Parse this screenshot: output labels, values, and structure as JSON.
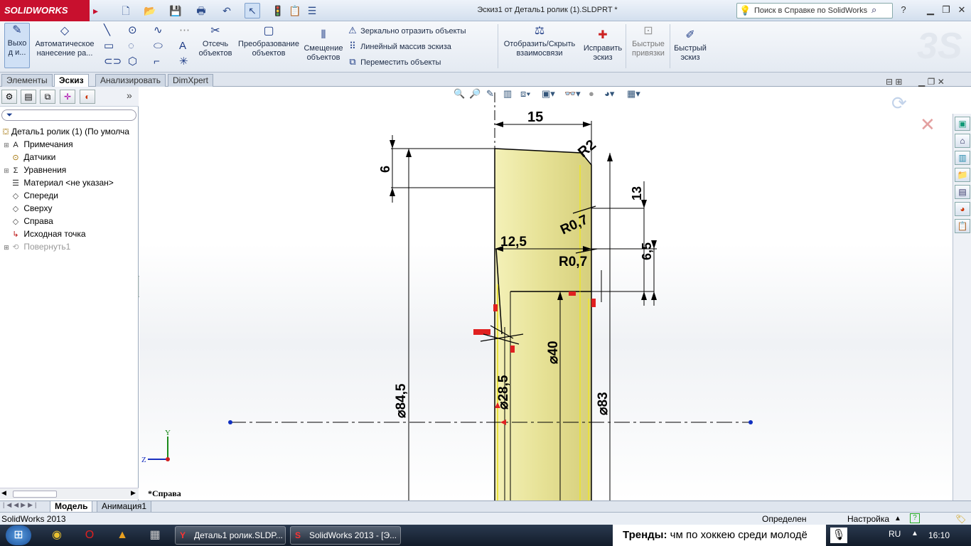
{
  "app": {
    "brand": "SOLIDWORKS",
    "doc_title": "Эскиз1 от Деталь1 ролик (1).SLDPRT *"
  },
  "help_search": {
    "placeholder": "Поиск в Справке по SolidWorks"
  },
  "ribbon": {
    "exit_sketch": "Выхо д и...",
    "auto_dim": "Автоматическое нанесение ра...",
    "trim": "Отсечь объектов",
    "convert": "Преобразование объектов",
    "offset": "Смещение объектов",
    "mirror": "Зеркально отразить объекты",
    "linear_pattern": "Линейный массив эскиза",
    "move": "Переместить объекты",
    "show_relations": "Отобразить/Скрыть взаимосвязи",
    "repair": "Исправить эскиз",
    "quick_snaps": "Быстрые привязки",
    "rapid_sketch": "Быстрый эскиз"
  },
  "tabs": [
    "Элементы",
    "Эскиз",
    "Анализировать",
    "DimXpert"
  ],
  "tree": [
    {
      "label": "Деталь1 ролик (1)  (По умолча",
      "icon": "part-icon"
    },
    {
      "label": "Примечания",
      "icon": "annotations-icon"
    },
    {
      "label": "Датчики",
      "icon": "sensors-icon"
    },
    {
      "label": "Уравнения",
      "icon": "equations-icon"
    },
    {
      "label": "Материал <не указан>",
      "icon": "material-icon"
    },
    {
      "label": "Спереди",
      "icon": "plane-icon"
    },
    {
      "label": "Сверху",
      "icon": "plane-icon"
    },
    {
      "label": "Справа",
      "icon": "plane-icon"
    },
    {
      "label": "Исходная точка",
      "icon": "origin-icon"
    },
    {
      "label": "Повернуть1",
      "icon": "revolve-icon"
    }
  ],
  "drawing": {
    "view_label": "*Справа",
    "dims": {
      "d15": "15",
      "d6": "6",
      "r2": "R2",
      "d13": "13",
      "r07a": "R0,7",
      "r07b": "R0,7",
      "d125": "12,5",
      "d65": "6,5",
      "d40": "⌀40",
      "d845": "⌀84,5",
      "d285": "⌀28,5",
      "d83": "⌀83"
    },
    "triad": {
      "y": "Y",
      "z": "Z"
    }
  },
  "bottom_tabs": [
    "Модель",
    "Анимация1"
  ],
  "status": {
    "app_version": "SolidWorks 2013",
    "state": "Определен",
    "settings": "Настройка"
  },
  "taskbar": {
    "app1": "Деталь1 ролик.SLDP...",
    "app2": "SolidWorks 2013 - [Э...",
    "trends_label": "Тренды:",
    "trends_text": "чм по хоккею среди молодё",
    "lang": "RU",
    "time": "16:10"
  }
}
